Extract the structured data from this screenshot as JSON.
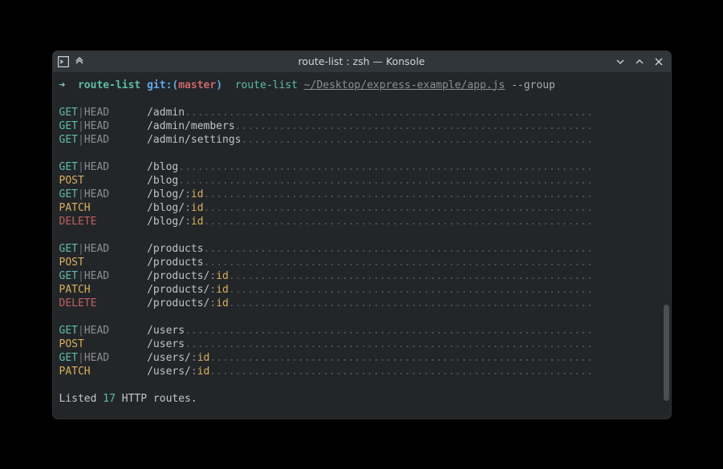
{
  "window": {
    "title": "route-list : zsh — Konsole"
  },
  "prompt": {
    "arrow": "➜ ",
    "cwd": "route-list",
    "git_label": "git:",
    "open_paren": "(",
    "branch": "master",
    "close_paren": ")",
    "cmd_name": "route-list",
    "cmd_path": "~/Desktop/express-example/app.js",
    "cmd_flag": "--group"
  },
  "method_colors": {
    "GET": "m-get",
    "POST": "m-post",
    "PATCH": "m-patch",
    "DELETE": "m-delete"
  },
  "method_width": 14,
  "line_width": 85,
  "routes": [
    [
      {
        "methods": [
          "GET",
          "HEAD"
        ],
        "path": "/admin"
      },
      {
        "methods": [
          "GET",
          "HEAD"
        ],
        "path": "/admin/members"
      },
      {
        "methods": [
          "GET",
          "HEAD"
        ],
        "path": "/admin/settings"
      }
    ],
    [
      {
        "methods": [
          "GET",
          "HEAD"
        ],
        "path": "/blog"
      },
      {
        "methods": [
          "POST"
        ],
        "path": "/blog"
      },
      {
        "methods": [
          "GET",
          "HEAD"
        ],
        "path": "/blog/",
        "param": "id"
      },
      {
        "methods": [
          "PATCH"
        ],
        "path": "/blog/",
        "param": "id"
      },
      {
        "methods": [
          "DELETE"
        ],
        "path": "/blog/",
        "param": "id"
      }
    ],
    [
      {
        "methods": [
          "GET",
          "HEAD"
        ],
        "path": "/products"
      },
      {
        "methods": [
          "POST"
        ],
        "path": "/products"
      },
      {
        "methods": [
          "GET",
          "HEAD"
        ],
        "path": "/products/",
        "param": "id"
      },
      {
        "methods": [
          "PATCH"
        ],
        "path": "/products/",
        "param": "id"
      },
      {
        "methods": [
          "DELETE"
        ],
        "path": "/products/",
        "param": "id"
      }
    ],
    [
      {
        "methods": [
          "GET",
          "HEAD"
        ],
        "path": "/users"
      },
      {
        "methods": [
          "POST"
        ],
        "path": "/users"
      },
      {
        "methods": [
          "GET",
          "HEAD"
        ],
        "path": "/users/",
        "param": "id"
      },
      {
        "methods": [
          "PATCH"
        ],
        "path": "/users/",
        "param": "id"
      }
    ]
  ],
  "summary": {
    "prefix": "Listed ",
    "count": "17",
    "suffix": " HTTP routes."
  }
}
